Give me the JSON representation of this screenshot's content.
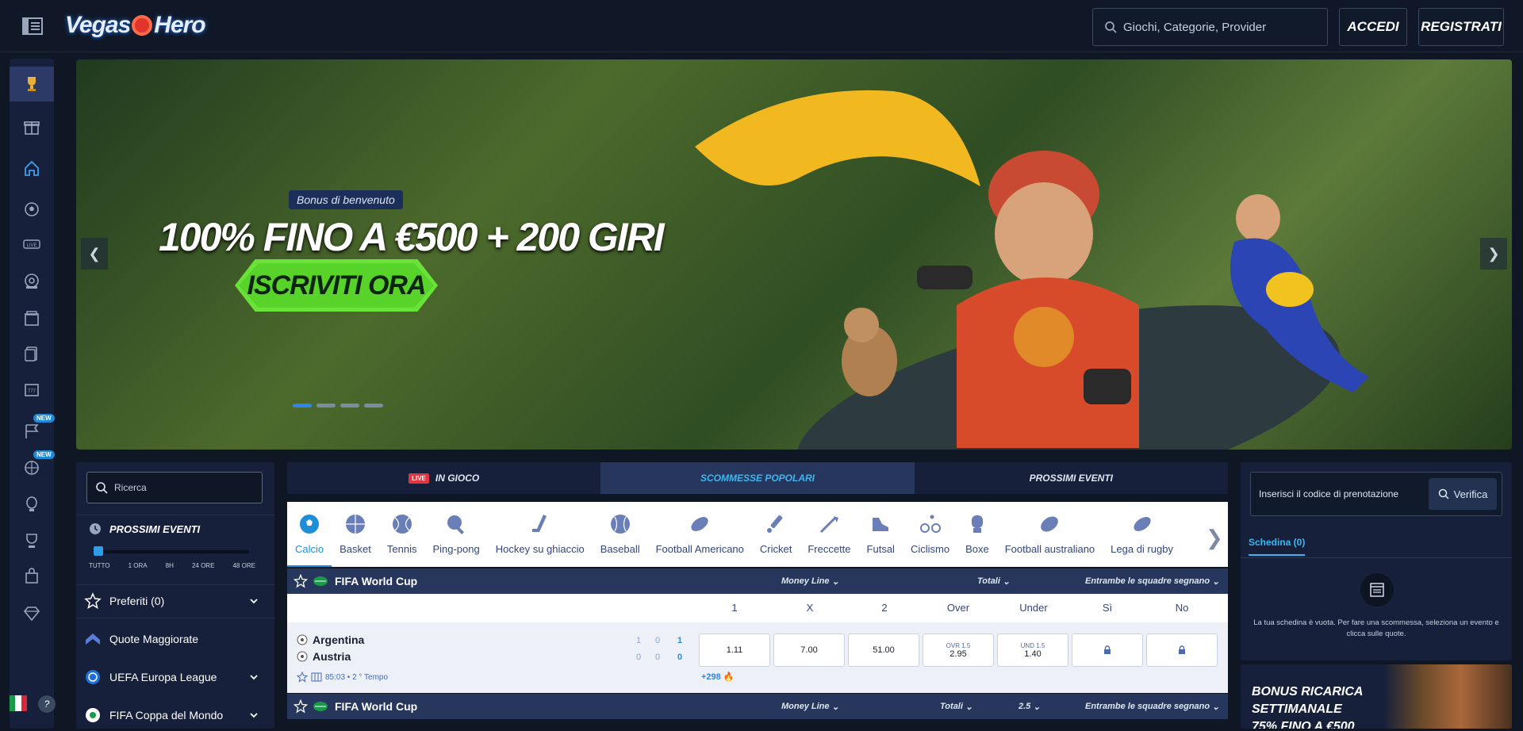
{
  "header": {
    "logo_text_1": "Vegas",
    "logo_text_2": "Hero",
    "search_placeholder": "Giochi, Categorie, Provider",
    "login": "ACCEDI",
    "register": "REGISTRATI"
  },
  "sidebar": {
    "icons": [
      "trophy-icon",
      "gift-icon",
      "home-icon",
      "soccer-icon",
      "live-icon",
      "casino-icon",
      "slots-icon",
      "cards-icon",
      "jackpot-icon",
      "racing-icon",
      "crystal-ball-icon",
      "hot-air-balloon-icon",
      "cup-icon",
      "shop-icon",
      "diamond-icon"
    ],
    "new_badge": "NEW"
  },
  "hero": {
    "tag": "Bonus di benvenuto",
    "title": "100% FINO A €500 + 200 GIRI",
    "cta": "ISCRIVITI ORA",
    "slides": 4,
    "active_slide": 1
  },
  "left_panel": {
    "search_placeholder": "Ricerca",
    "upcoming": "PROSSIMI EVENTI",
    "ticks": [
      "TUTTO",
      "1 ORA",
      "8H",
      "24 ORE",
      "48 ORE"
    ],
    "items": [
      {
        "label": "Preferiti (0)",
        "icon": "star-icon",
        "expand": true
      },
      {
        "label": "Quote Maggiorate",
        "icon": "boost-icon",
        "expand": false
      },
      {
        "label": "UEFA Europa League",
        "icon": "europa-league-icon",
        "expand": true
      },
      {
        "label": "FIFA Coppa del Mondo",
        "icon": "world-cup-icon",
        "expand": true
      }
    ]
  },
  "tabs": {
    "live_badge": "LIVE",
    "in_play": "IN GIOCO",
    "popular": "SCOMMESSE POPOLARI",
    "upcoming": "PROSSIMI EVENTI"
  },
  "sports": [
    "Calcio",
    "Basket",
    "Tennis",
    "Ping-pong",
    "Hockey su ghiaccio",
    "Baseball",
    "Football Americano",
    "Cricket",
    "Freccette",
    "Futsal",
    "Ciclismo",
    "Boxe",
    "Football australiano",
    "Lega di rugby"
  ],
  "competition_1": {
    "name": "FIFA World Cup",
    "markets": [
      "Money Line",
      "Totali",
      "Entrambe le squadre segnano"
    ]
  },
  "columns": [
    "1",
    "X",
    "2",
    "Over",
    "Under",
    "Sì",
    "No"
  ],
  "match": {
    "home": "Argentina",
    "away": "Austria",
    "home_scores": [
      "1",
      "0",
      "1"
    ],
    "away_scores": [
      "0",
      "0",
      "0"
    ],
    "time": "85:03 • 2 ° Tempo",
    "more_markets": "+298",
    "odds": {
      "one": "1.11",
      "x": "7.00",
      "two": "51.00",
      "over_label": "OVR 1.5",
      "over": "2.95",
      "under_label": "UND 1.5",
      "under": "1.40"
    }
  },
  "competition_2": {
    "name": "FIFA World Cup",
    "markets": [
      "Money Line",
      "Totali",
      "2.5",
      "Entrambe le squadre segnano"
    ]
  },
  "betslip": {
    "code_placeholder": "Inserisci il codice di prenotazione",
    "verify": "Verifica",
    "tab": "Schedina (0)",
    "empty": "La tua schedina è vuota. Per fare una scommessa, seleziona un evento e clicca sulle quote."
  },
  "promo": {
    "line1": "BONUS RICARICA",
    "line2": "SETTIMANALE",
    "line3": "75% FINO A €500"
  }
}
